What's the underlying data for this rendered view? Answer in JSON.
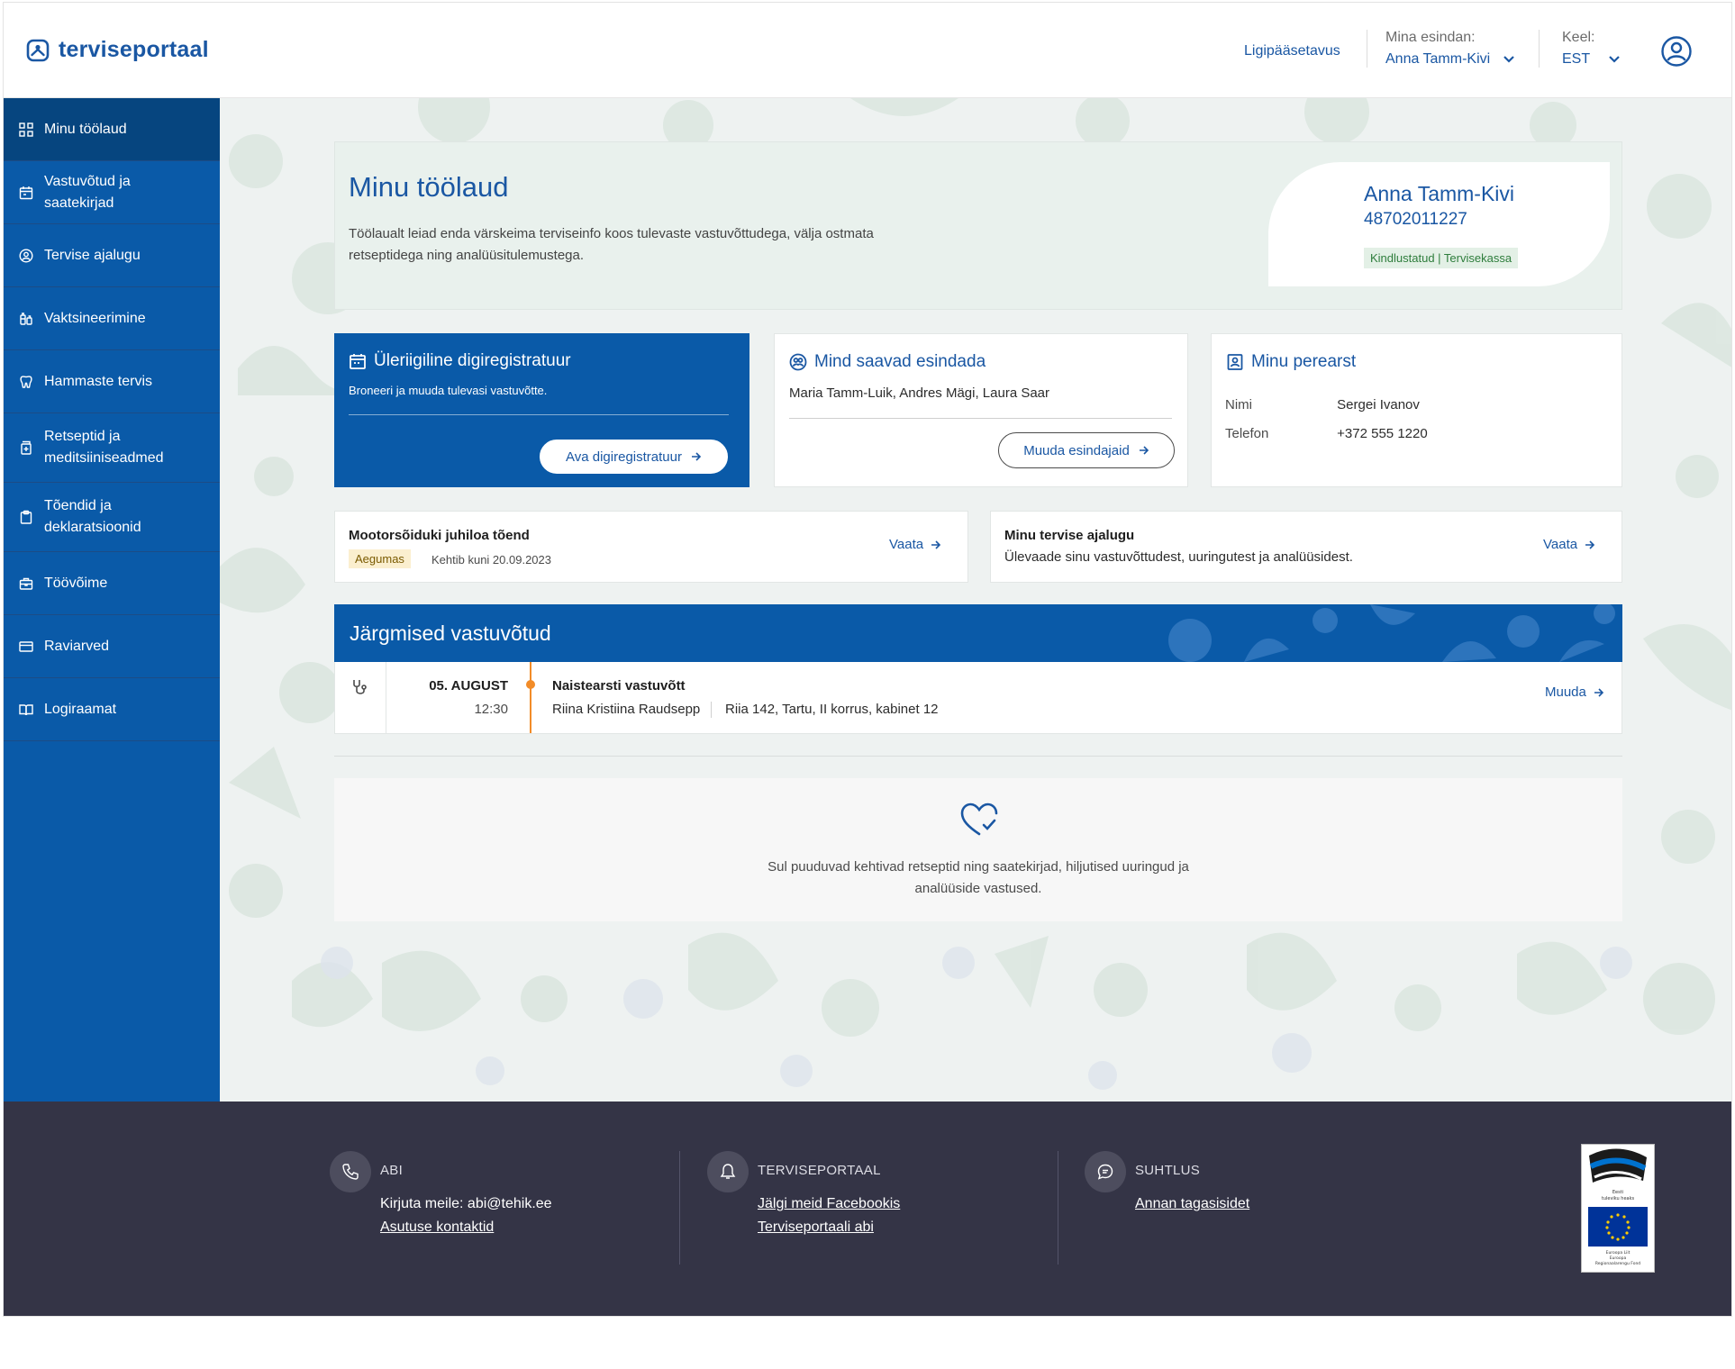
{
  "header": {
    "logo": "terviseportaal",
    "accessibility": "Ligipääsetavus",
    "represent_label": "Mina esindan:",
    "represent_value": "Anna Tamm-Kivi",
    "lang_label": "Keel:",
    "lang_value": "EST"
  },
  "sidebar": {
    "items": [
      {
        "label": "Minu töölaud",
        "icon": "dashboard-icon",
        "active": true
      },
      {
        "label": "Vastuvõtud ja saatekirjad",
        "icon": "calendar-icon"
      },
      {
        "label": "Tervise ajalugu",
        "icon": "person-circle-icon"
      },
      {
        "label": "Vaktsineerimine",
        "icon": "vaccine-icon"
      },
      {
        "label": "Hammaste tervis",
        "icon": "tooth-icon"
      },
      {
        "label": "Retseptid ja meditsiiniseadmed",
        "icon": "medicine-icon"
      },
      {
        "label": "Tõendid ja deklaratsioonid",
        "icon": "clipboard-icon"
      },
      {
        "label": "Töövõime",
        "icon": "briefcase-icon"
      },
      {
        "label": "Raviarved",
        "icon": "card-icon"
      },
      {
        "label": "Logiraamat",
        "icon": "book-icon"
      }
    ]
  },
  "hero": {
    "title": "Minu töölaud",
    "description": "Töölaualt leiad enda värskeima terviseinfo koos tulevaste vastuvõttudega, välja ostmata retseptidega ning analüüsitulemustega.",
    "person_name": "Anna Tamm-Kivi",
    "person_code": "48702011227",
    "insurance": "Kindlustatud | Tervisekassa"
  },
  "digiregistratuur": {
    "title": "Üleriigiline digiregistratuur",
    "subtitle": "Broneeri ja muuda tulevasi vastuvõtte.",
    "button": "Ava digiregistratuur"
  },
  "representatives": {
    "title": "Mind saavad esindada",
    "names": "Maria Tamm-Luik, Andres Mägi, Laura Saar",
    "button": "Muuda esindajaid"
  },
  "family_doctor": {
    "title": "Minu perearst",
    "name_label": "Nimi",
    "name_value": "Sergei Ivanov",
    "phone_label": "Telefon",
    "phone_value": "+372 555 1220"
  },
  "permit": {
    "title": "Mootorsõiduki juhiloa tõend",
    "status": "Aegumas",
    "valid_until": "Kehtib kuni 20.09.2023",
    "link": "Vaata"
  },
  "history": {
    "title": "Minu tervise ajalugu",
    "description": "Ülevaade sinu vastuvõttudest, uuringutest ja analüüsidest.",
    "link": "Vaata"
  },
  "appointments": {
    "title": "Järgmised vastuvõtud",
    "items": [
      {
        "date": "05. AUGUST",
        "time": "12:30",
        "type": "Naistearsti vastuvõtt",
        "doctor": "Riina Kristiina Raudsepp",
        "location": "Riia 142, Tartu, II korrus, kabinet 12",
        "action": "Muuda"
      }
    ]
  },
  "empty_state": {
    "text": "Sul puuduvad kehtivad retseptid ning saatekirjad, hiljutised uuringud ja analüüside vastused."
  },
  "footer": {
    "help": {
      "heading": "ABI",
      "line1": "Kirjuta meile: abi@tehik.ee",
      "line2": "Asutuse kontaktid"
    },
    "portal": {
      "heading": "TERVISEPORTAAL",
      "line1": "Jälgi meid Facebookis",
      "line2": "Terviseportaali abi"
    },
    "contact": {
      "heading": "SUHTLUS",
      "line1": "Annan tagasisidet"
    },
    "eu_logo_text": "Eesti tuleviku heaks · Euroopa Liit Euroopa Regionaalarengu Fond"
  },
  "colors": {
    "brand_blue": "#0a5aa8",
    "accent_orange": "#f28c28",
    "footer_bg": "#343446"
  }
}
